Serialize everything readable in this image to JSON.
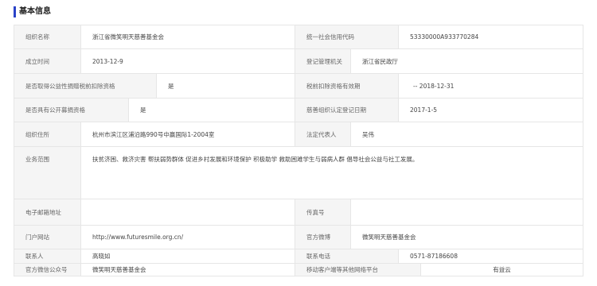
{
  "section": {
    "title": "基本信息"
  },
  "rows": [
    {
      "l1": "组织名称",
      "v1": "浙江省微笑明天慈善基金会",
      "l2": "统一社会信用代码",
      "v2": "53330000A933770284"
    },
    {
      "l1": "成立时间",
      "v1": "2013-12-9",
      "l2": "登记管理机关",
      "v2": "浙江省民政厅"
    },
    {
      "l1": "是否取得公益性捐赠税前扣除资格",
      "v1": "是",
      "l2": "税前扣除资格有效期",
      "v2": "-- 2018-12-31"
    },
    {
      "l1": "是否具有公开募捐资格",
      "v1": "是",
      "l2": "慈善组织认定登记日期",
      "v2": "2017-1-5"
    },
    {
      "l1": "组织住所",
      "v1": "杭州市滨江区浦沿路990号中赢国际1-2004室",
      "l2": "法定代表人",
      "v2": "吴伟"
    },
    {
      "l1": "业务范围",
      "v1": "扶贫济困、救济灾害 帮扶弱势群体 促进乡村发展和环境保护 积极助学 救助困难学生与弱病人群 倡导社会公益与社工发展。"
    },
    {
      "l1": "电子邮箱地址",
      "v1": "",
      "l2": "传真号",
      "v2": ""
    },
    {
      "l1": "门户网站",
      "v1": "http://www.futuresmile.org.cn/",
      "l2": "官方微博",
      "v2": "微笑明天慈善基金会"
    },
    {
      "l1": "联系人",
      "v1": "高晓如",
      "l2": "联系电话",
      "v2": "0571-87186608"
    },
    {
      "l1": "官方微信公众号",
      "v1": "微笑明天慈善基金会",
      "l2": "移动客户端等其他网络平台",
      "v2": "有益云"
    }
  ]
}
